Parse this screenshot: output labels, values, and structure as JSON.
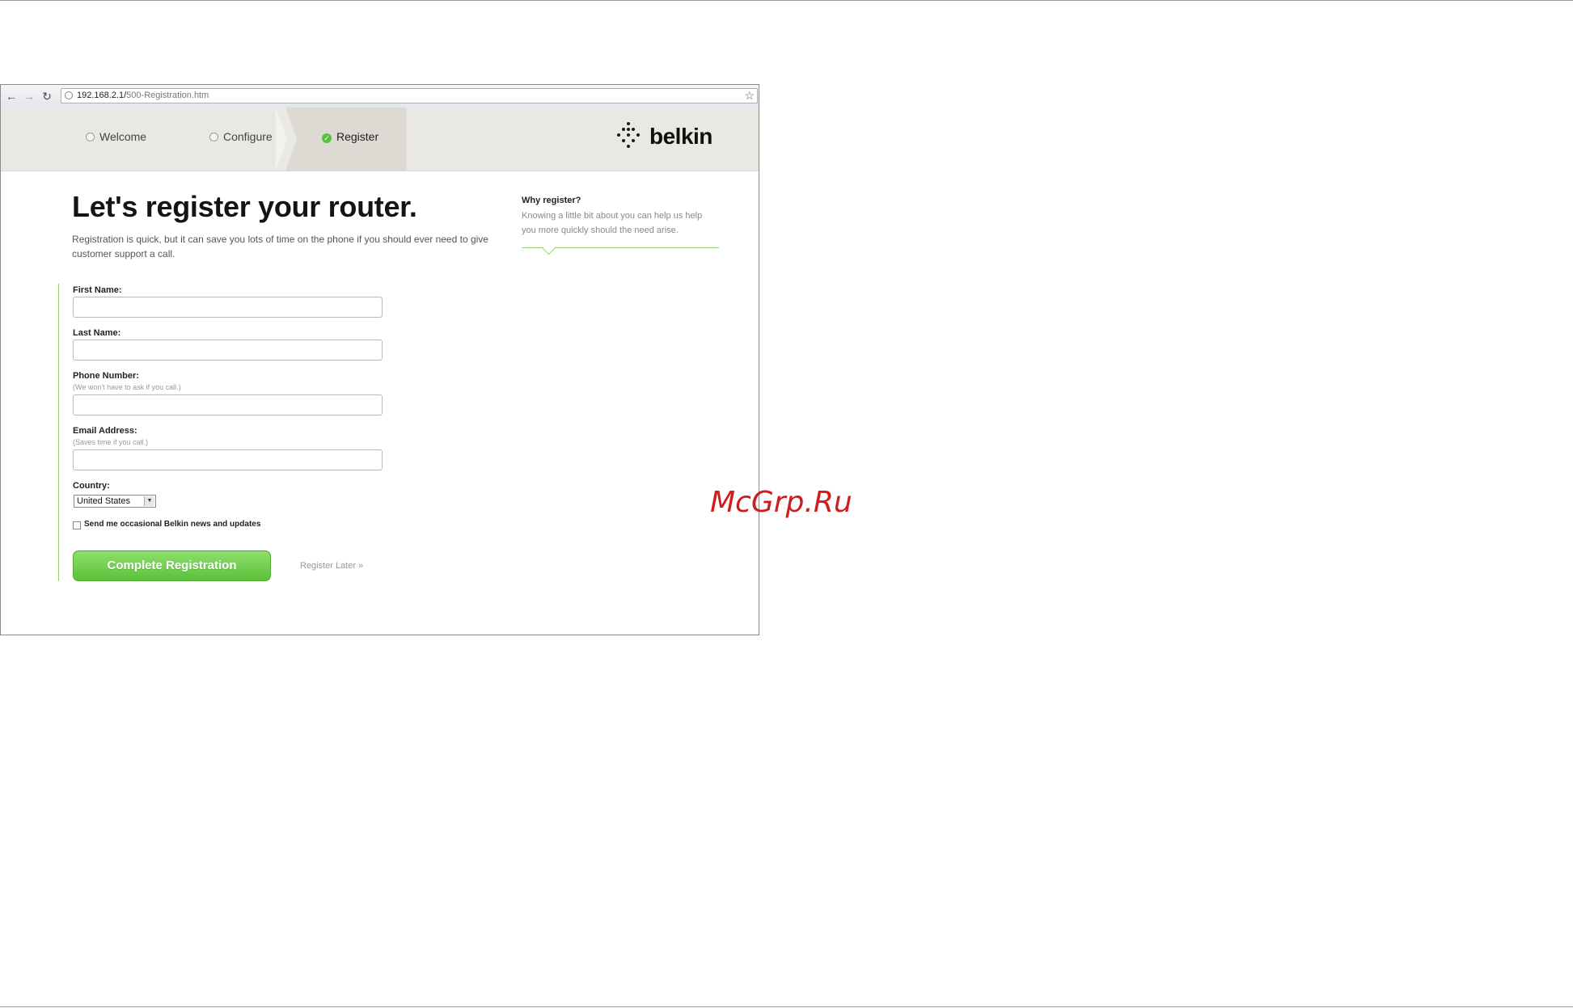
{
  "browser": {
    "url_host": "192.168.2.1/",
    "url_path": "500-Registration.htm",
    "back_icon": "arrow-left",
    "forward_icon": "arrow-right",
    "reload_icon": "reload",
    "bookmark_icon": "star"
  },
  "steps": [
    {
      "label": "Welcome",
      "state": "incomplete"
    },
    {
      "label": "Configure",
      "state": "incomplete"
    },
    {
      "label": "Register",
      "state": "current"
    }
  ],
  "brand": {
    "name": "belkin"
  },
  "main": {
    "title": "Let's register your router.",
    "intro": "Registration is quick, but it can save you lots of time on the phone if you should ever need to give customer support a call."
  },
  "sidebar": {
    "title": "Why register?",
    "text": "Knowing a little bit about you can help us help you more quickly should the need arise."
  },
  "form": {
    "first_name_label": "First Name:",
    "first_name_value": "",
    "last_name_label": "Last Name:",
    "last_name_value": "",
    "phone_label": "Phone Number:",
    "phone_hint": "(We won't have to ask if you call.)",
    "phone_value": "",
    "email_label": "Email Address:",
    "email_hint": "(Saves time if you call.)",
    "email_value": "",
    "country_label": "Country:",
    "country_value": "United States",
    "newsletter_label": "Send me occasional Belkin news and updates",
    "newsletter_checked": false,
    "submit_label": "Complete Registration",
    "later_label": "Register Later »"
  },
  "watermark": "McGrp.Ru",
  "colors": {
    "accent_green": "#5cc13a",
    "watermark_red": "#d01c1c"
  }
}
